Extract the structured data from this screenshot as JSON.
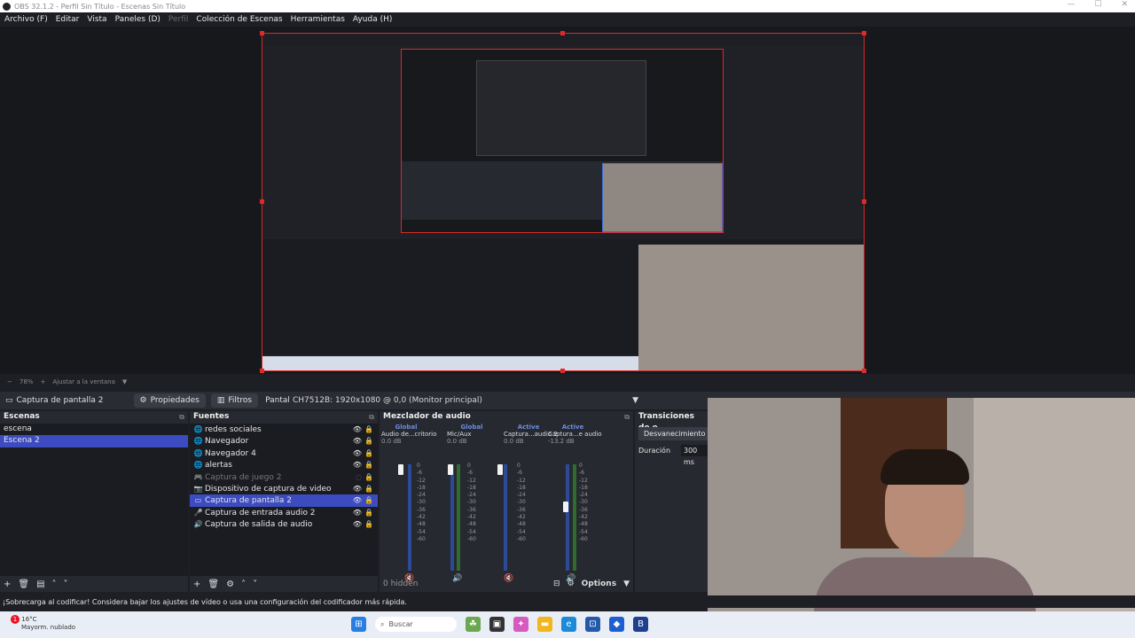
{
  "window": {
    "title": "OBS 32.1.2 - Perfil Sin Título - Escenas Sin Título"
  },
  "menu": [
    "Archivo (F)",
    "Editar",
    "Vista",
    "Paneles (D)",
    "Perfil",
    "Colección de Escenas",
    "Herramientas",
    "Ayuda (H)"
  ],
  "zoom": {
    "value": "78%",
    "fit": "Ajustar a la ventana"
  },
  "toolbar": {
    "source": "Captura de pantalla 2",
    "properties": "Propiedades",
    "filters": "Filtros",
    "display_label": "Pantalla",
    "display_value": "CH7512B: 1920x1080 @ 0,0 (Monitor principal)"
  },
  "scenes": {
    "title": "Escenas",
    "items": [
      "escena",
      "Escena 2"
    ],
    "selected": "Escena 2"
  },
  "sources": {
    "title": "Fuentes",
    "items": [
      "redes sociales",
      "Navegador",
      "Navegador 4",
      "alertas",
      "Captura de juego 2",
      "Dispositivo de captura de video",
      "Captura de pantalla 2",
      "Captura de entrada audio 2",
      "Captura de salida de audio"
    ],
    "icons": [
      "globe-icon",
      "globe-icon",
      "globe-icon",
      "globe-icon",
      "gamepad-icon",
      "camera-icon",
      "monitor-icon",
      "mic-icon",
      "speaker-icon"
    ],
    "selected": "Captura de pantalla 2"
  },
  "mixer": {
    "title": "Mezclador de audio",
    "channels": [
      {
        "tag": "Global",
        "name": "Audio de...critorio",
        "db": "0.0 dB",
        "level": 0.95
      },
      {
        "tag": "Global",
        "name": "Mic/Aux",
        "db": "0.0 dB",
        "level": 0.95
      },
      {
        "tag": "Active",
        "name": "Captura...audio 2",
        "db": "0.0 dB",
        "level": 0.95
      },
      {
        "tag": "Active",
        "name": "Captura...e audio",
        "db": "-13.2 dB",
        "level": 0.6
      }
    ],
    "ticks": [
      "0",
      "-6",
      "-12",
      "-18",
      "-24",
      "-30",
      "-36",
      "-42",
      "-48",
      "-54",
      "-60"
    ],
    "hidden": "0 hidden",
    "options": "Options"
  },
  "transitions": {
    "title": "Transiciones de e",
    "type": "Desvanecimiento",
    "duration_label": "Duración",
    "duration_value": "300 ms"
  },
  "status": {
    "message": "¡Sobrecarga al codificar! Considera bajar los ajustes de vídeo o usa una configuración del codificador más rápida."
  },
  "taskbar": {
    "temp": "16°C",
    "weather": "Mayorm. nublado",
    "search": "Buscar",
    "notif": "1"
  },
  "colors": {
    "selection": "#3c4cc0",
    "accent_red": "#e02a2a",
    "panel": "#272930",
    "list_bg": "#1b1c21"
  }
}
